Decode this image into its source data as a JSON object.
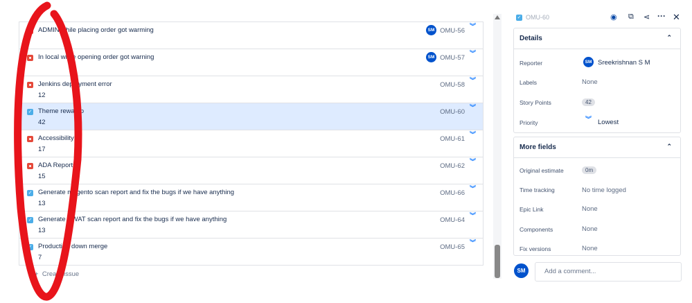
{
  "issues": [
    {
      "summary": "ADMIN while placing order got warming",
      "points": "",
      "key": "OMU-56",
      "type": "bug",
      "assignee": "SM"
    },
    {
      "summary": "In local while opening order got warning",
      "points": "",
      "key": "OMU-57",
      "type": "bug",
      "assignee": "SM"
    },
    {
      "summary": "Jenkins deployment error",
      "points": "12",
      "key": "OMU-58",
      "type": "bug"
    },
    {
      "summary": "Theme rewamp",
      "points": "42",
      "key": "OMU-60",
      "type": "task",
      "selected": true
    },
    {
      "summary": "Accessibility",
      "points": "17",
      "key": "OMU-61",
      "type": "bug"
    },
    {
      "summary": "ADA Reports",
      "points": "15",
      "key": "OMU-62",
      "type": "bug"
    },
    {
      "summary": "Generate magento scan report and fix the bugs if we have anything",
      "points": "13",
      "key": "OMU-66",
      "type": "task"
    },
    {
      "summary": "Generate SWAT scan report and fix the bugs if we have anything",
      "points": "13",
      "key": "OMU-64",
      "type": "task"
    },
    {
      "summary": "Production down merge",
      "points": "7",
      "key": "OMU-65",
      "type": "task"
    }
  ],
  "create_issue": "Create issue",
  "detail": {
    "key": "OMU-60",
    "details_title": "Details",
    "reporter_label": "Reporter",
    "reporter": "Sreekrishnan S M",
    "reporter_initials": "SM",
    "labels_label": "Labels",
    "labels": "None",
    "story_points_label": "Story Points",
    "story_points": "42",
    "priority_label": "Priority",
    "priority": "Lowest",
    "more_title": "More fields",
    "orig_label": "Original estimate",
    "orig": "0m",
    "time_label": "Time tracking",
    "time": "No time logged",
    "epic_label": "Epic Link",
    "epic": "None",
    "comp_label": "Components",
    "comp": "None",
    "fix_label": "Fix versions",
    "fix": "None",
    "comment_placeholder": "Add a comment...",
    "user_initials": "SM"
  },
  "colors": {
    "accent": "#0052cc",
    "bug": "#e5493a",
    "task": "#4bade8",
    "selected": "#deebff",
    "annotation": "#e8141b"
  }
}
